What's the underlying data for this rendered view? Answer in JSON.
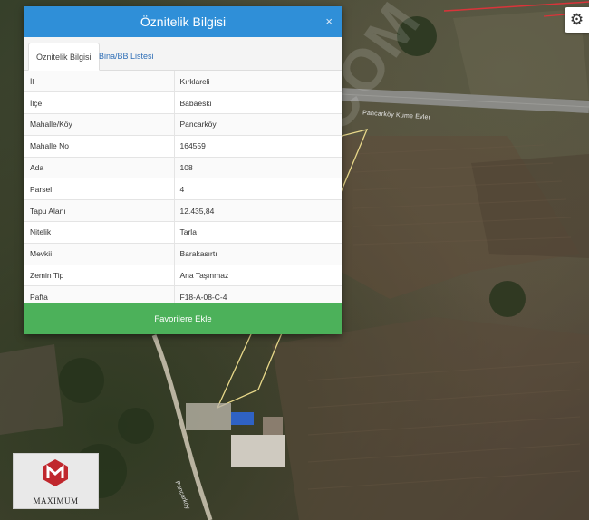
{
  "panel": {
    "title": "Öznitelik Bilgisi",
    "close_symbol": "×",
    "tabs": [
      {
        "label": "Öznitelik Bilgisi",
        "active": true
      },
      {
        "label": "Bina/BB Listesi",
        "active": false
      }
    ],
    "rows": [
      {
        "key": "İl",
        "value": "Kırklareli"
      },
      {
        "key": "İlçe",
        "value": "Babaeski"
      },
      {
        "key": "Mahalle/Köy",
        "value": "Pancarköy"
      },
      {
        "key": "Mahalle No",
        "value": "164559"
      },
      {
        "key": "Ada",
        "value": "108"
      },
      {
        "key": "Parsel",
        "value": "4"
      },
      {
        "key": "Tapu Alanı",
        "value": "12.435,84"
      },
      {
        "key": "Nitelik",
        "value": "Tarla"
      },
      {
        "key": "Mevkii",
        "value": "Barakasırtı"
      },
      {
        "key": "Zemin Tip",
        "value": "Ana Taşınmaz"
      },
      {
        "key": "Pafta",
        "value": "F18-A-08-C-4"
      }
    ],
    "favorites_label": "Favorilere Ekle"
  },
  "map": {
    "road_label": "Pancarköy Kume Evler",
    "road_label_2": "Pancarköy",
    "watermark": "ADVIS.COM",
    "settings_icon": "gear-icon"
  },
  "logo": {
    "text": "MAXIMUM",
    "colors": {
      "mark": "#c0272d"
    }
  },
  "colors": {
    "header": "#2f8fd8",
    "favorites": "#4cb15a",
    "tab_link": "#2f6fb7"
  }
}
